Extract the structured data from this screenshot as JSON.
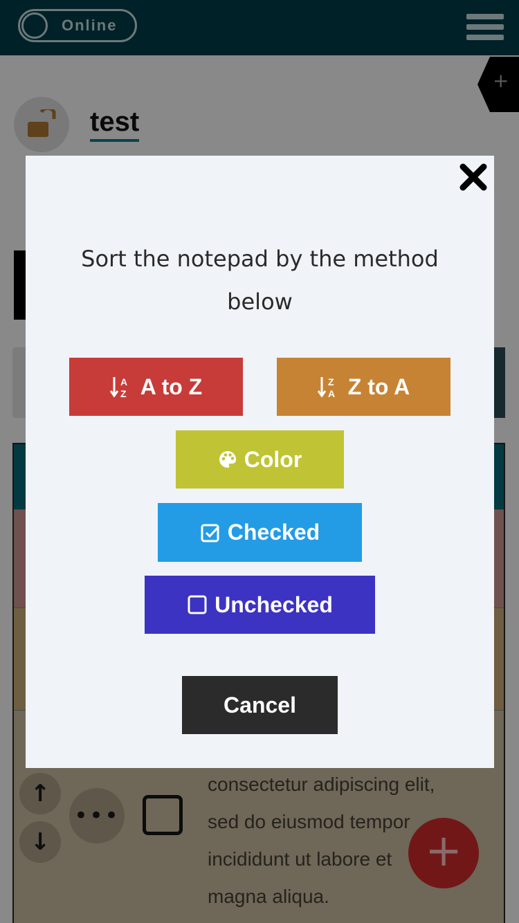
{
  "app": {
    "status_toggle_label": "Online",
    "note_title": "test",
    "lorem_lines": [
      "consectetur adipiscing elit,",
      "sed do eiusmod tempor",
      "incididunt ut labore et",
      "magna aliqua."
    ]
  },
  "modal": {
    "message": "Sort the notepad by the method below",
    "buttons": {
      "az": "A to Z",
      "za": "Z to A",
      "color": "Color",
      "checked": "Checked",
      "unchecked": "Unchecked",
      "cancel": "Cancel"
    },
    "icons": {
      "az": "sort-alpha-down-icon",
      "za": "sort-alpha-up-icon",
      "color": "palette-icon",
      "checked": "check-square-icon",
      "unchecked": "square-icon",
      "close": "close-icon"
    }
  },
  "colors": {
    "az": "#c73c38",
    "za": "#c78334",
    "color": "#c0c434",
    "checked": "#239ce5",
    "unchecked": "#3c33c3",
    "cancel": "#2b2b2b",
    "header": "#00262d"
  }
}
